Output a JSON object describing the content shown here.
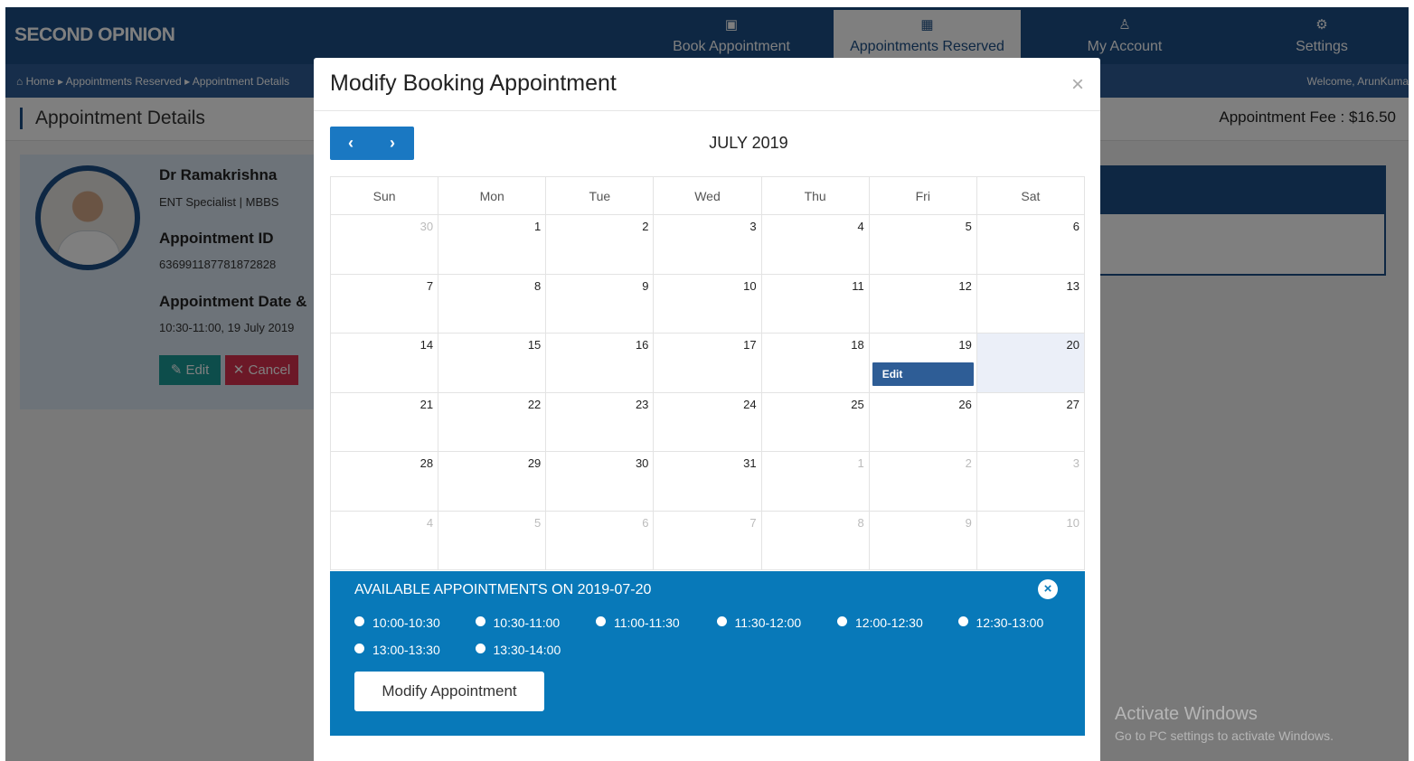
{
  "brand": "SECOND OPINION",
  "nav": {
    "book": "Book Appointment",
    "reserved": "Appointments Reserved",
    "account": "My Account",
    "settings": "Settings"
  },
  "breadcrumb": {
    "home": "Home",
    "reserved": "Appointments Reserved",
    "details": "Appointment Details",
    "welcome": "Welcome, ArunKuma"
  },
  "page": {
    "title": "Appointment Details",
    "fee": "Appointment Fee : $16.50"
  },
  "doctor": {
    "name": "Dr Ramakrishna",
    "specialty": "ENT Specialist | MBBS",
    "id_label": "Appointment ID",
    "id_value": "636991187781872828",
    "date_label": "Appointment Date &",
    "date_value": "10:30-11:00, 19 July 2019",
    "edit_label": "Edit",
    "cancel_label": "Cancel"
  },
  "modal": {
    "title": "Modify Booking Appointment",
    "close": "×",
    "prev": "‹",
    "next": "›",
    "month": "JULY 2019",
    "weekdays": [
      "Sun",
      "Mon",
      "Tue",
      "Wed",
      "Thu",
      "Fri",
      "Sat"
    ],
    "weeks": [
      [
        {
          "d": "30",
          "o": true
        },
        {
          "d": "1"
        },
        {
          "d": "2"
        },
        {
          "d": "3"
        },
        {
          "d": "4"
        },
        {
          "d": "5"
        },
        {
          "d": "6"
        }
      ],
      [
        {
          "d": "7"
        },
        {
          "d": "8"
        },
        {
          "d": "9"
        },
        {
          "d": "10"
        },
        {
          "d": "11"
        },
        {
          "d": "12"
        },
        {
          "d": "13"
        }
      ],
      [
        {
          "d": "14"
        },
        {
          "d": "15"
        },
        {
          "d": "16"
        },
        {
          "d": "17"
        },
        {
          "d": "18"
        },
        {
          "d": "19",
          "event": "Edit"
        },
        {
          "d": "20",
          "selected": true
        }
      ],
      [
        {
          "d": "21"
        },
        {
          "d": "22"
        },
        {
          "d": "23"
        },
        {
          "d": "24"
        },
        {
          "d": "25"
        },
        {
          "d": "26"
        },
        {
          "d": "27"
        }
      ],
      [
        {
          "d": "28"
        },
        {
          "d": "29"
        },
        {
          "d": "30"
        },
        {
          "d": "31"
        },
        {
          "d": "1",
          "o": true
        },
        {
          "d": "2",
          "o": true
        },
        {
          "d": "3",
          "o": true
        }
      ],
      [
        {
          "d": "4",
          "o": true
        },
        {
          "d": "5",
          "o": true
        },
        {
          "d": "6",
          "o": true
        },
        {
          "d": "7",
          "o": true
        },
        {
          "d": "8",
          "o": true
        },
        {
          "d": "9",
          "o": true
        },
        {
          "d": "10",
          "o": true
        }
      ]
    ],
    "available_title": "AVAILABLE APPOINTMENTS ON 2019-07-20",
    "available_close": "×",
    "slots": [
      "10:00-10:30",
      "10:30-11:00",
      "11:00-11:30",
      "11:30-12:00",
      "12:00-12:30",
      "12:30-13:00",
      "13:00-13:30",
      "13:30-14:00"
    ],
    "modify_label": "Modify Appointment"
  },
  "watermark": {
    "line1": "Activate Windows",
    "line2": "Go to PC settings to activate Windows."
  }
}
